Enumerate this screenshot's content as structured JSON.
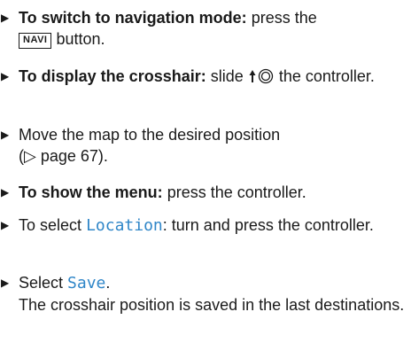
{
  "instructions": {
    "step1": {
      "bold": "To switch to navigation mode:",
      "text_before_key": "press the",
      "key_label": "NAVI",
      "text_after_key": "button."
    },
    "step2": {
      "bold": "To display the crosshair:",
      "text_before_icon": "slide",
      "icon": "controller-slide-up-icon",
      "text_after_icon": "the controller."
    },
    "step3": {
      "text": "Move the map to the desired position",
      "reference": "(▷ page 67)."
    },
    "step4": {
      "bold": "To show the menu:",
      "text": "press the controller."
    },
    "step5": {
      "text_before": "To select",
      "display_word": "Location",
      "text_after": ": turn and press the controller."
    },
    "step6": {
      "text_before": "Select",
      "display_word": "Save",
      "text_after": ".",
      "result": "The crosshair position is saved in the last destinations."
    },
    "colors": {
      "display_text": "#2f86c8",
      "body_text": "#1a1a1a"
    }
  }
}
